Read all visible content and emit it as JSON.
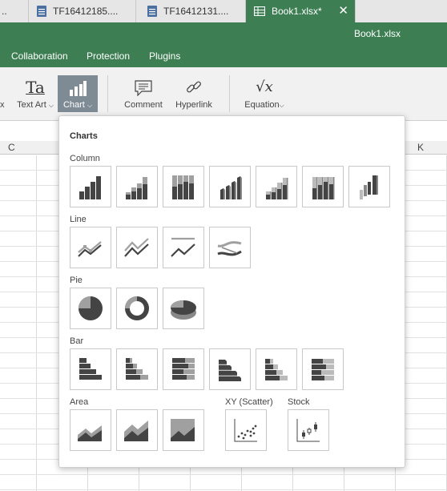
{
  "tabs": [
    {
      "label": "..",
      "icon": "document-icon"
    },
    {
      "label": "TF16412185....",
      "icon": "document-icon"
    },
    {
      "label": "TF16412131....",
      "icon": "document-icon"
    },
    {
      "label": "Book1.xlsx*",
      "icon": "spreadsheet-icon",
      "active": true,
      "close": "✕"
    }
  ],
  "window_title": "Book1.xlsx",
  "menu": [
    "Collaboration",
    "Protection",
    "Plugins"
  ],
  "toolbar": {
    "prev_fragment": "x",
    "text_art": "Text Art",
    "chart": "Chart",
    "comment": "Comment",
    "hyperlink": "Hyperlink",
    "equation": "Equation",
    "text_art_glyph": "Ta",
    "equation_glyph": "√x"
  },
  "sheet": {
    "columns": [
      "C",
      "K"
    ]
  },
  "charts_popup": {
    "title": "Charts",
    "sections": {
      "column": "Column",
      "line": "Line",
      "pie": "Pie",
      "bar": "Bar",
      "area": "Area",
      "scatter": "XY (Scatter)",
      "stock": "Stock"
    }
  },
  "colors": {
    "accent": "#3d7e53",
    "chart_selected": "#7e8b95",
    "icon_dark": "#444444",
    "icon_light": "#a0a0a0"
  }
}
